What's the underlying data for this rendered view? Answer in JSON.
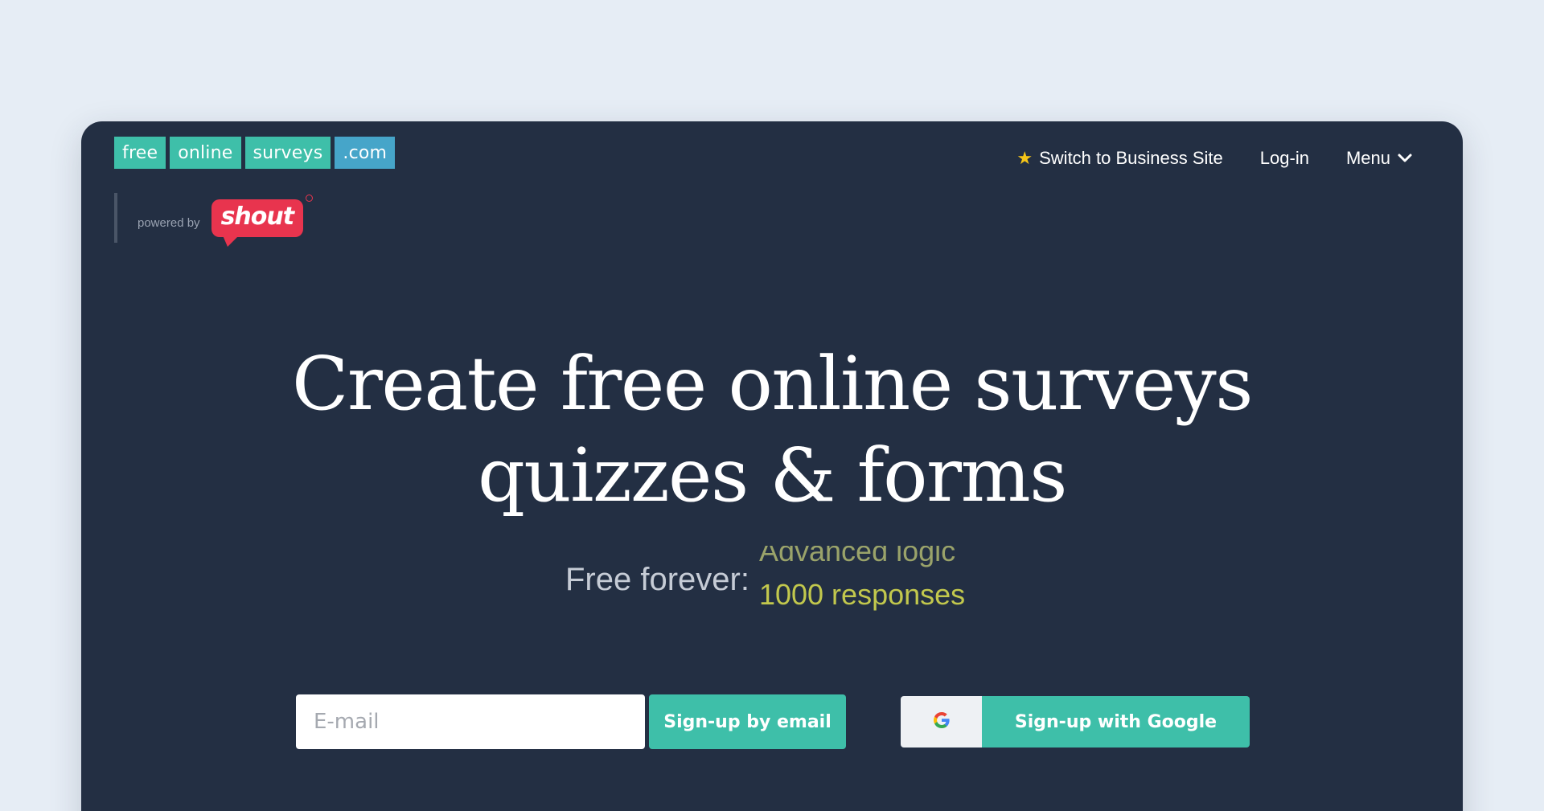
{
  "logo": {
    "parts": [
      "free",
      "online",
      "surveys",
      ".com"
    ],
    "powered_by": "powered by",
    "partner": "shout"
  },
  "nav": {
    "switch_label": "Switch to Business Site",
    "login_label": "Log-in",
    "menu_label": "Menu"
  },
  "hero": {
    "line1": "Create free online surveys",
    "line2": "quizzes & forms"
  },
  "subtitle": {
    "label": "Free forever:",
    "ticker_items": [
      "Advanced logic",
      "1000 responses"
    ]
  },
  "signup": {
    "email_placeholder": "E-mail",
    "email_button": "Sign-up by email",
    "google_button": "Sign-up with Google"
  },
  "colors": {
    "background": "#e6edf5",
    "card": "#232f43",
    "accent_teal": "#3ebfa9",
    "accent_blue": "#46a5c9",
    "brand_red": "#e8344e",
    "ticker_olive": "#c2c84d"
  },
  "icons": {
    "switch": "star-icon",
    "menu": "chevron-down-icon",
    "google": "google-g-icon"
  }
}
